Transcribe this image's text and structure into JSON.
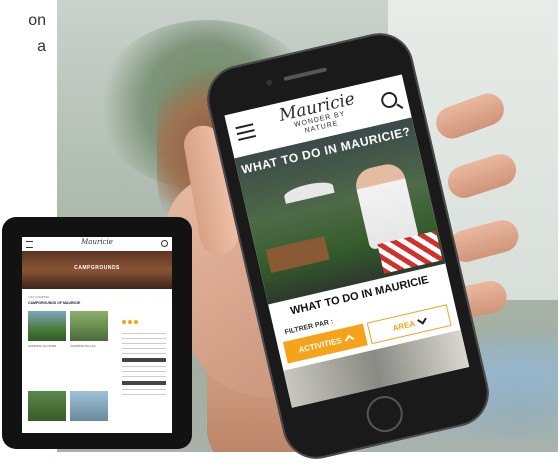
{
  "caption": {
    "line1": "on",
    "line2": "a"
  },
  "phone": {
    "logo_top": "Mauricie",
    "logo_bottom": "WONDER BY NATURE",
    "hero_title": "WHAT TO DO IN MAURICIE?",
    "section_title": "WHAT TO DO IN MAURICIE",
    "filter_label": "FILTRER PAR :",
    "buttons": {
      "activities": "ACTIVITIES",
      "area": "AREA"
    },
    "accent_color": "#f6a21a"
  },
  "tablet": {
    "logo": "Mauricie",
    "hero_title": "CAMPGROUNDS",
    "tag": "LIST CAMPING",
    "heading": "CAMPGROUNDS OF MAURICIE",
    "items": [
      {
        "title": "CAMPING LE NORD"
      },
      {
        "title": "CAMPING DU LAC"
      }
    ]
  }
}
